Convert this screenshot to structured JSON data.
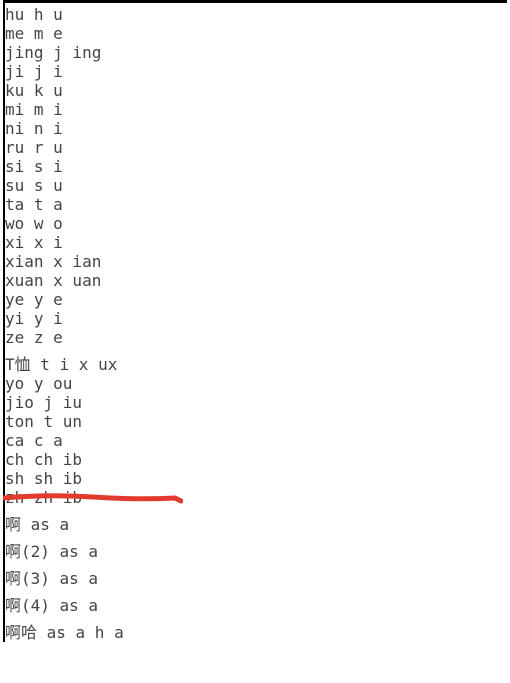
{
  "block1": [
    "hu h u",
    "me m e",
    "jing j ing",
    "ji j i",
    "ku k u",
    "mi m i",
    "ni n i",
    "ru r u",
    "si s i",
    "su s u",
    "ta t a",
    "wo w o",
    "xi x i",
    "xian x ian",
    "xuan x uan",
    "ye y e",
    "yi y i",
    "ze z e"
  ],
  "block2": [
    "T恤 t i x ux",
    "yo y ou",
    "jio j iu",
    "ton t un",
    "ca c a",
    "ch ch ib",
    "sh sh ib",
    "zh zh ib"
  ],
  "block3": [
    "啊 as a",
    "啊(2) as a",
    "啊(3) as a",
    "啊(4) as a",
    "啊哈 as a h a"
  ],
  "annotation": {
    "color": "#e23b2e"
  }
}
